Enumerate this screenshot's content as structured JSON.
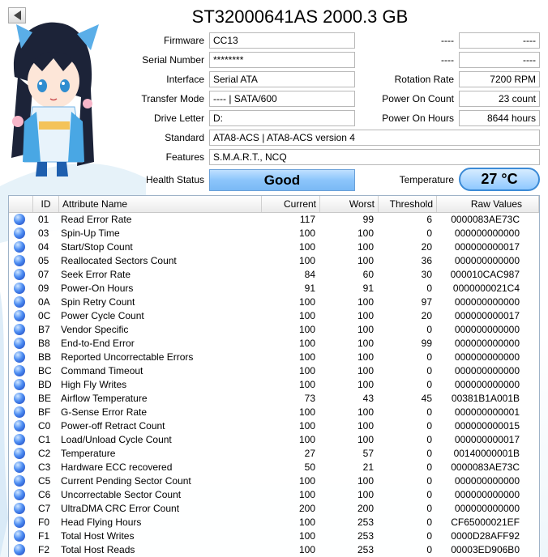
{
  "disk": {
    "title": "ST32000641AS 2000.3 GB"
  },
  "info_left": [
    {
      "label": "Firmware",
      "value": "CC13"
    },
    {
      "label": "Serial Number",
      "value": "********"
    },
    {
      "label": "Interface",
      "value": "Serial ATA"
    },
    {
      "label": "Transfer Mode",
      "value": "---- | SATA/600"
    },
    {
      "label": "Drive Letter",
      "value": "D:"
    },
    {
      "label": "Standard",
      "value": "ATA8-ACS | ATA8-ACS version 4"
    },
    {
      "label": "Features",
      "value": "S.M.A.R.T., NCQ"
    }
  ],
  "info_right": [
    {
      "label": "----",
      "value": "----"
    },
    {
      "label": "----",
      "value": "----"
    },
    {
      "label": "Rotation Rate",
      "value": "7200 RPM"
    },
    {
      "label": "Power On Count",
      "value": "23 count"
    },
    {
      "label": "Power On Hours",
      "value": "8644 hours"
    }
  ],
  "health": {
    "label": "Health Status",
    "value": "Good",
    "color": "#8cc5fb"
  },
  "temperature": {
    "label": "Temperature",
    "value": "27 °C",
    "color": "#8fc8ff"
  },
  "table": {
    "headers": [
      "ID",
      "Attribute Name",
      "Current",
      "Worst",
      "Threshold",
      "Raw Values"
    ],
    "status_icon": "blue-circle-icon",
    "rows": [
      {
        "id": "01",
        "name": "Read Error Rate",
        "current": "117",
        "worst": "99",
        "threshold": "6",
        "raw": "0000083AE73C"
      },
      {
        "id": "03",
        "name": "Spin-Up Time",
        "current": "100",
        "worst": "100",
        "threshold": "0",
        "raw": "000000000000"
      },
      {
        "id": "04",
        "name": "Start/Stop Count",
        "current": "100",
        "worst": "100",
        "threshold": "20",
        "raw": "000000000017"
      },
      {
        "id": "05",
        "name": "Reallocated Sectors Count",
        "current": "100",
        "worst": "100",
        "threshold": "36",
        "raw": "000000000000"
      },
      {
        "id": "07",
        "name": "Seek Error Rate",
        "current": "84",
        "worst": "60",
        "threshold": "30",
        "raw": "000010CAC987"
      },
      {
        "id": "09",
        "name": "Power-On Hours",
        "current": "91",
        "worst": "91",
        "threshold": "0",
        "raw": "0000000021C4"
      },
      {
        "id": "0A",
        "name": "Spin Retry Count",
        "current": "100",
        "worst": "100",
        "threshold": "97",
        "raw": "000000000000"
      },
      {
        "id": "0C",
        "name": "Power Cycle Count",
        "current": "100",
        "worst": "100",
        "threshold": "20",
        "raw": "000000000017"
      },
      {
        "id": "B7",
        "name": "Vendor Specific",
        "current": "100",
        "worst": "100",
        "threshold": "0",
        "raw": "000000000000"
      },
      {
        "id": "B8",
        "name": "End-to-End Error",
        "current": "100",
        "worst": "100",
        "threshold": "99",
        "raw": "000000000000"
      },
      {
        "id": "BB",
        "name": "Reported Uncorrectable Errors",
        "current": "100",
        "worst": "100",
        "threshold": "0",
        "raw": "000000000000"
      },
      {
        "id": "BC",
        "name": "Command Timeout",
        "current": "100",
        "worst": "100",
        "threshold": "0",
        "raw": "000000000000"
      },
      {
        "id": "BD",
        "name": "High Fly Writes",
        "current": "100",
        "worst": "100",
        "threshold": "0",
        "raw": "000000000000"
      },
      {
        "id": "BE",
        "name": "Airflow Temperature",
        "current": "73",
        "worst": "43",
        "threshold": "45",
        "raw": "00381B1A001B"
      },
      {
        "id": "BF",
        "name": "G-Sense Error Rate",
        "current": "100",
        "worst": "100",
        "threshold": "0",
        "raw": "000000000001"
      },
      {
        "id": "C0",
        "name": "Power-off Retract Count",
        "current": "100",
        "worst": "100",
        "threshold": "0",
        "raw": "000000000015"
      },
      {
        "id": "C1",
        "name": "Load/Unload Cycle Count",
        "current": "100",
        "worst": "100",
        "threshold": "0",
        "raw": "000000000017"
      },
      {
        "id": "C2",
        "name": "Temperature",
        "current": "27",
        "worst": "57",
        "threshold": "0",
        "raw": "00140000001B"
      },
      {
        "id": "C3",
        "name": "Hardware ECC recovered",
        "current": "50",
        "worst": "21",
        "threshold": "0",
        "raw": "0000083AE73C"
      },
      {
        "id": "C5",
        "name": "Current Pending Sector Count",
        "current": "100",
        "worst": "100",
        "threshold": "0",
        "raw": "000000000000"
      },
      {
        "id": "C6",
        "name": "Uncorrectable Sector Count",
        "current": "100",
        "worst": "100",
        "threshold": "0",
        "raw": "000000000000"
      },
      {
        "id": "C7",
        "name": "UltraDMA CRC Error Count",
        "current": "200",
        "worst": "200",
        "threshold": "0",
        "raw": "000000000000"
      },
      {
        "id": "F0",
        "name": "Head Flying Hours",
        "current": "100",
        "worst": "253",
        "threshold": "0",
        "raw": "CF65000021EF"
      },
      {
        "id": "F1",
        "name": "Total Host Writes",
        "current": "100",
        "worst": "253",
        "threshold": "0",
        "raw": "0000D28AFF92"
      },
      {
        "id": "F2",
        "name": "Total Host Reads",
        "current": "100",
        "worst": "253",
        "threshold": "0",
        "raw": "00003ED906B0"
      }
    ]
  }
}
